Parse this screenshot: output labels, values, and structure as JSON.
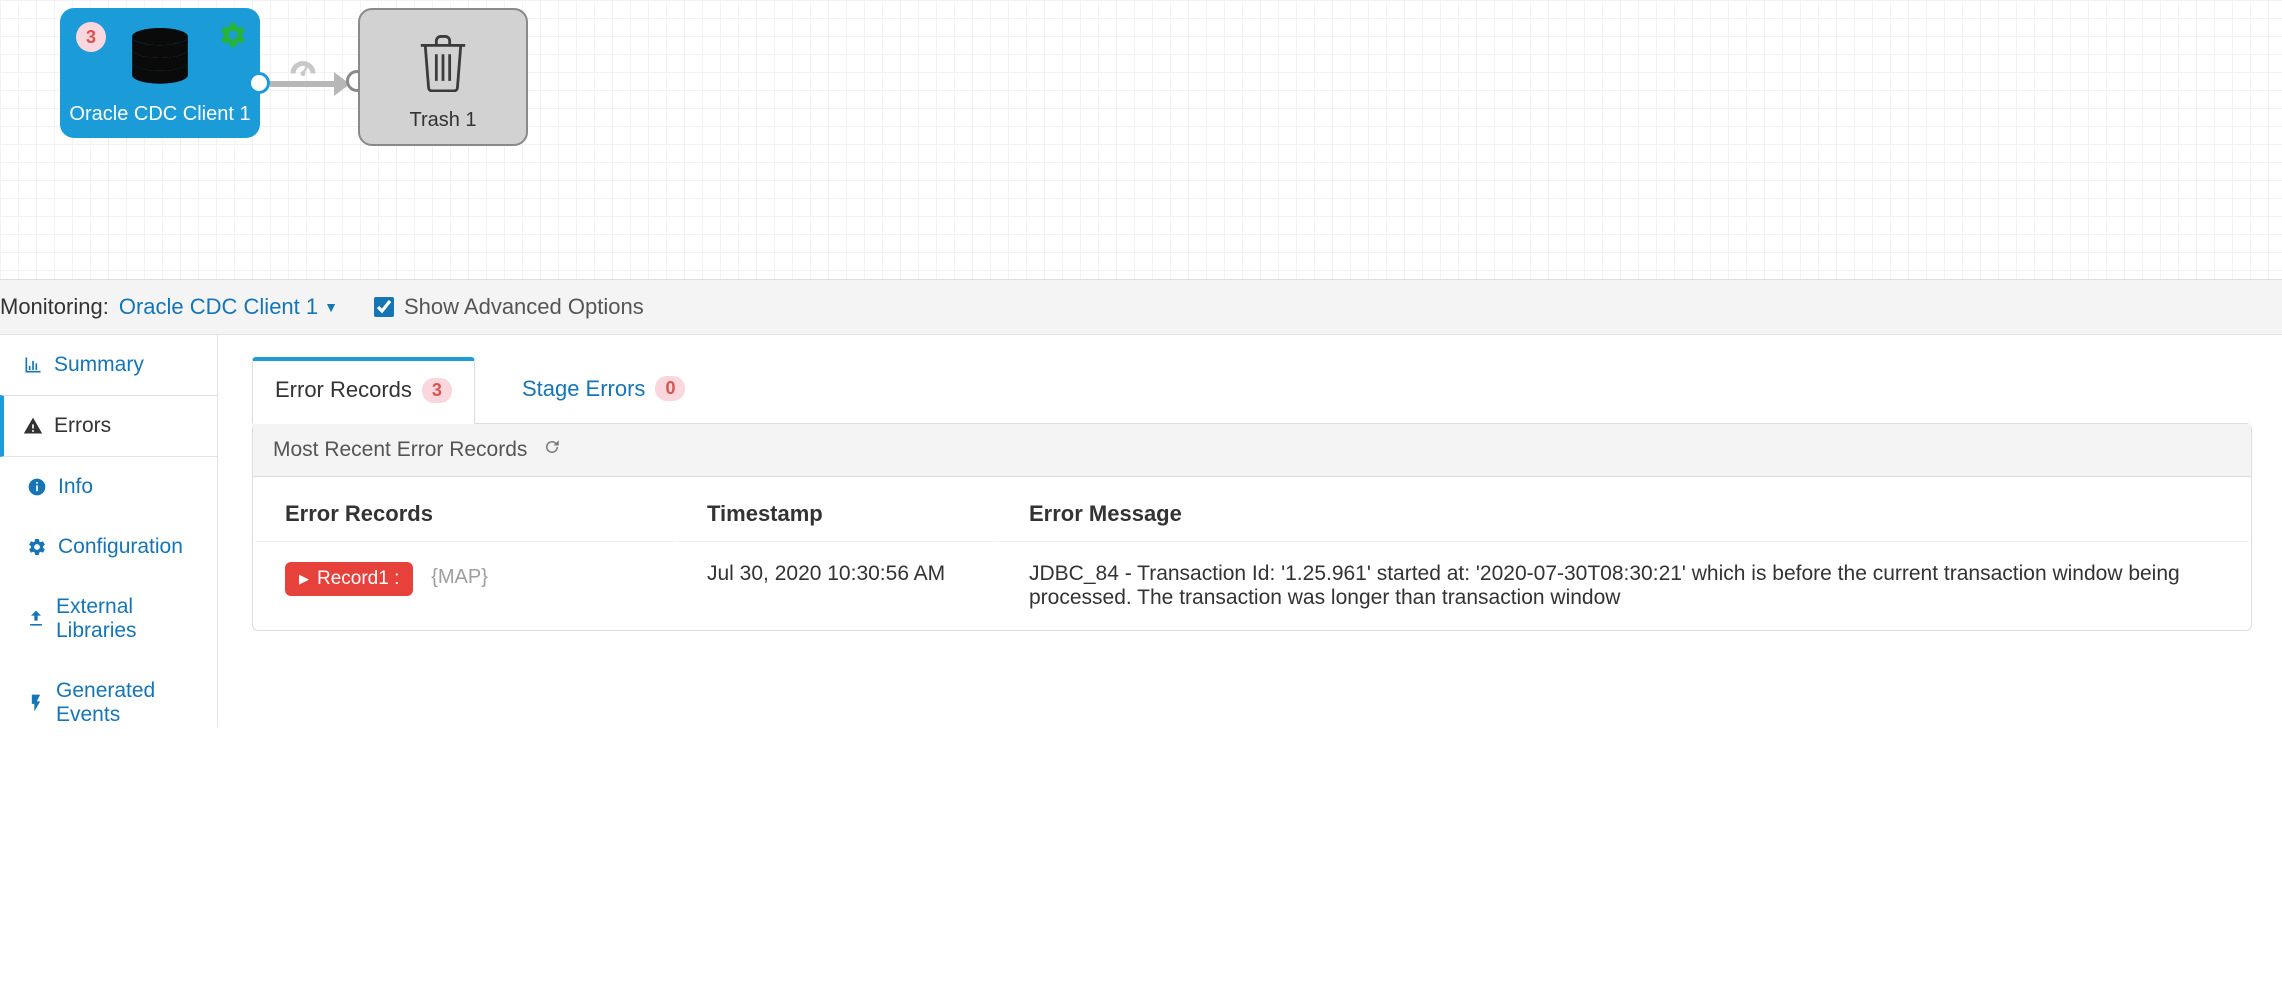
{
  "canvas": {
    "origin": {
      "label": "Oracle CDC Client 1",
      "badge": "3"
    },
    "dest": {
      "label": "Trash 1"
    }
  },
  "monitor": {
    "title": "Monitoring:",
    "link": "Oracle CDC Client 1",
    "show_advanced_label": "Show Advanced Options"
  },
  "nav": {
    "summary": "Summary",
    "errors": "Errors",
    "info": "Info",
    "configuration": "Configuration",
    "external_libraries": "External Libraries",
    "generated_events": "Generated Events"
  },
  "tabs": {
    "error_records": {
      "label": "Error Records",
      "count": "3"
    },
    "stage_errors": {
      "label": "Stage Errors",
      "count": "0"
    }
  },
  "panel": {
    "title": "Most Recent Error Records",
    "columns": {
      "error_records": "Error Records",
      "timestamp": "Timestamp",
      "error_message": "Error Message"
    },
    "rows": [
      {
        "record_label": "Record1 :",
        "map": "{MAP}",
        "timestamp": "Jul 30, 2020 10:30:56 AM",
        "message": "JDBC_84 - Transaction Id: '1.25.961' started at: '2020-07-30T08:30:21' which is before the current transaction window being processed. The transaction was longer than transaction window"
      }
    ]
  }
}
